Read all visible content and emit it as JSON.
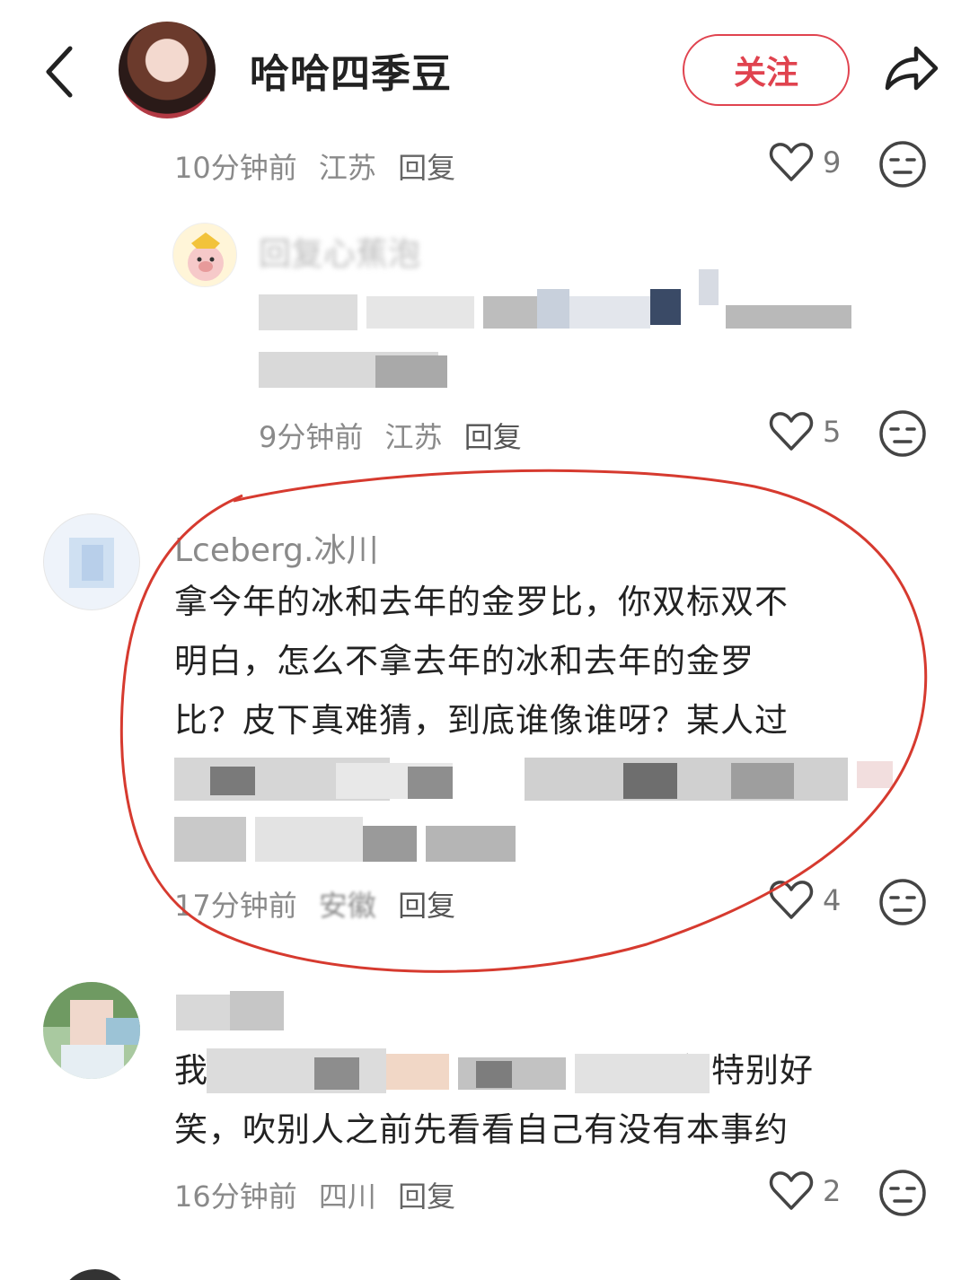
{
  "header": {
    "author_name": "哈哈四季豆",
    "follow_label": "关注"
  },
  "comment_top": {
    "time": "10分钟前",
    "location": "江苏",
    "reply": "回复",
    "likes": "9"
  },
  "reply_1": {
    "username": "回复心蕉泡",
    "text_line1": "",
    "text_line2": "",
    "time": "9分钟前",
    "location": "江苏",
    "reply": "回复",
    "likes": "5"
  },
  "comment_main": {
    "username": "Lceberg.冰川",
    "lines": [
      "拿今年的冰和去年的金罗比，你双标双不",
      "明白，怎么不拿去年的冰和去年的金罗",
      "比？皮下真难猜，到底谁像谁呀？某人过",
      "",
      ""
    ],
    "time": "17分钟前",
    "location": "安徽",
    "reply": "回复",
    "likes": "4"
  },
  "comment_last": {
    "username": "",
    "line1": "我觉得",
    "line1_end": "部特别好",
    "line2": "笑，吹别人之前先看看自己有没有本事约",
    "time": "16分钟前",
    "location": "四川",
    "reply": "回复",
    "likes": "2"
  },
  "colors": {
    "accent": "#e0434f",
    "meta": "#8a8a8a",
    "annotation": "#d63a2f"
  },
  "icons": [
    "back-icon",
    "share-icon",
    "heart-icon",
    "emoji-face-icon"
  ]
}
